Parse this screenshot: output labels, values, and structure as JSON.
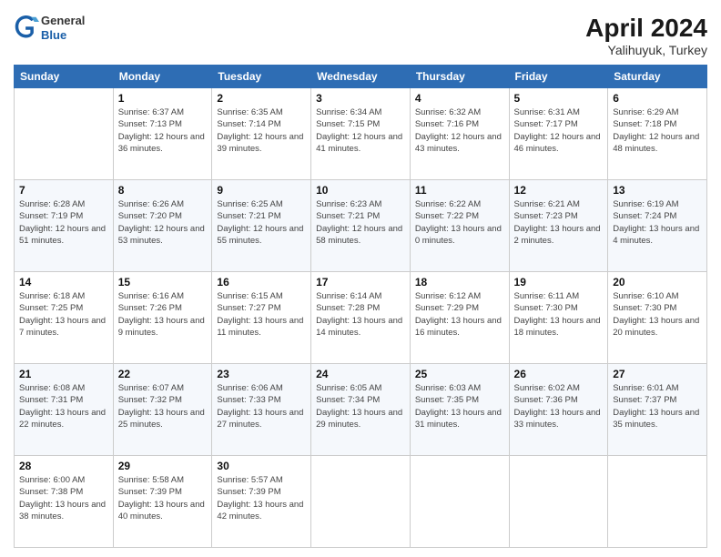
{
  "header": {
    "logo_general": "General",
    "logo_blue": "Blue",
    "title": "April 2024",
    "subtitle": "Yalihuyuk, Turkey"
  },
  "columns": [
    "Sunday",
    "Monday",
    "Tuesday",
    "Wednesday",
    "Thursday",
    "Friday",
    "Saturday"
  ],
  "weeks": [
    [
      {
        "day": "",
        "sunrise": "",
        "sunset": "",
        "daylight": ""
      },
      {
        "day": "1",
        "sunrise": "Sunrise: 6:37 AM",
        "sunset": "Sunset: 7:13 PM",
        "daylight": "Daylight: 12 hours and 36 minutes."
      },
      {
        "day": "2",
        "sunrise": "Sunrise: 6:35 AM",
        "sunset": "Sunset: 7:14 PM",
        "daylight": "Daylight: 12 hours and 39 minutes."
      },
      {
        "day": "3",
        "sunrise": "Sunrise: 6:34 AM",
        "sunset": "Sunset: 7:15 PM",
        "daylight": "Daylight: 12 hours and 41 minutes."
      },
      {
        "day": "4",
        "sunrise": "Sunrise: 6:32 AM",
        "sunset": "Sunset: 7:16 PM",
        "daylight": "Daylight: 12 hours and 43 minutes."
      },
      {
        "day": "5",
        "sunrise": "Sunrise: 6:31 AM",
        "sunset": "Sunset: 7:17 PM",
        "daylight": "Daylight: 12 hours and 46 minutes."
      },
      {
        "day": "6",
        "sunrise": "Sunrise: 6:29 AM",
        "sunset": "Sunset: 7:18 PM",
        "daylight": "Daylight: 12 hours and 48 minutes."
      }
    ],
    [
      {
        "day": "7",
        "sunrise": "Sunrise: 6:28 AM",
        "sunset": "Sunset: 7:19 PM",
        "daylight": "Daylight: 12 hours and 51 minutes."
      },
      {
        "day": "8",
        "sunrise": "Sunrise: 6:26 AM",
        "sunset": "Sunset: 7:20 PM",
        "daylight": "Daylight: 12 hours and 53 minutes."
      },
      {
        "day": "9",
        "sunrise": "Sunrise: 6:25 AM",
        "sunset": "Sunset: 7:21 PM",
        "daylight": "Daylight: 12 hours and 55 minutes."
      },
      {
        "day": "10",
        "sunrise": "Sunrise: 6:23 AM",
        "sunset": "Sunset: 7:21 PM",
        "daylight": "Daylight: 12 hours and 58 minutes."
      },
      {
        "day": "11",
        "sunrise": "Sunrise: 6:22 AM",
        "sunset": "Sunset: 7:22 PM",
        "daylight": "Daylight: 13 hours and 0 minutes."
      },
      {
        "day": "12",
        "sunrise": "Sunrise: 6:21 AM",
        "sunset": "Sunset: 7:23 PM",
        "daylight": "Daylight: 13 hours and 2 minutes."
      },
      {
        "day": "13",
        "sunrise": "Sunrise: 6:19 AM",
        "sunset": "Sunset: 7:24 PM",
        "daylight": "Daylight: 13 hours and 4 minutes."
      }
    ],
    [
      {
        "day": "14",
        "sunrise": "Sunrise: 6:18 AM",
        "sunset": "Sunset: 7:25 PM",
        "daylight": "Daylight: 13 hours and 7 minutes."
      },
      {
        "day": "15",
        "sunrise": "Sunrise: 6:16 AM",
        "sunset": "Sunset: 7:26 PM",
        "daylight": "Daylight: 13 hours and 9 minutes."
      },
      {
        "day": "16",
        "sunrise": "Sunrise: 6:15 AM",
        "sunset": "Sunset: 7:27 PM",
        "daylight": "Daylight: 13 hours and 11 minutes."
      },
      {
        "day": "17",
        "sunrise": "Sunrise: 6:14 AM",
        "sunset": "Sunset: 7:28 PM",
        "daylight": "Daylight: 13 hours and 14 minutes."
      },
      {
        "day": "18",
        "sunrise": "Sunrise: 6:12 AM",
        "sunset": "Sunset: 7:29 PM",
        "daylight": "Daylight: 13 hours and 16 minutes."
      },
      {
        "day": "19",
        "sunrise": "Sunrise: 6:11 AM",
        "sunset": "Sunset: 7:30 PM",
        "daylight": "Daylight: 13 hours and 18 minutes."
      },
      {
        "day": "20",
        "sunrise": "Sunrise: 6:10 AM",
        "sunset": "Sunset: 7:30 PM",
        "daylight": "Daylight: 13 hours and 20 minutes."
      }
    ],
    [
      {
        "day": "21",
        "sunrise": "Sunrise: 6:08 AM",
        "sunset": "Sunset: 7:31 PM",
        "daylight": "Daylight: 13 hours and 22 minutes."
      },
      {
        "day": "22",
        "sunrise": "Sunrise: 6:07 AM",
        "sunset": "Sunset: 7:32 PM",
        "daylight": "Daylight: 13 hours and 25 minutes."
      },
      {
        "day": "23",
        "sunrise": "Sunrise: 6:06 AM",
        "sunset": "Sunset: 7:33 PM",
        "daylight": "Daylight: 13 hours and 27 minutes."
      },
      {
        "day": "24",
        "sunrise": "Sunrise: 6:05 AM",
        "sunset": "Sunset: 7:34 PM",
        "daylight": "Daylight: 13 hours and 29 minutes."
      },
      {
        "day": "25",
        "sunrise": "Sunrise: 6:03 AM",
        "sunset": "Sunset: 7:35 PM",
        "daylight": "Daylight: 13 hours and 31 minutes."
      },
      {
        "day": "26",
        "sunrise": "Sunrise: 6:02 AM",
        "sunset": "Sunset: 7:36 PM",
        "daylight": "Daylight: 13 hours and 33 minutes."
      },
      {
        "day": "27",
        "sunrise": "Sunrise: 6:01 AM",
        "sunset": "Sunset: 7:37 PM",
        "daylight": "Daylight: 13 hours and 35 minutes."
      }
    ],
    [
      {
        "day": "28",
        "sunrise": "Sunrise: 6:00 AM",
        "sunset": "Sunset: 7:38 PM",
        "daylight": "Daylight: 13 hours and 38 minutes."
      },
      {
        "day": "29",
        "sunrise": "Sunrise: 5:58 AM",
        "sunset": "Sunset: 7:39 PM",
        "daylight": "Daylight: 13 hours and 40 minutes."
      },
      {
        "day": "30",
        "sunrise": "Sunrise: 5:57 AM",
        "sunset": "Sunset: 7:39 PM",
        "daylight": "Daylight: 13 hours and 42 minutes."
      },
      {
        "day": "",
        "sunrise": "",
        "sunset": "",
        "daylight": ""
      },
      {
        "day": "",
        "sunrise": "",
        "sunset": "",
        "daylight": ""
      },
      {
        "day": "",
        "sunrise": "",
        "sunset": "",
        "daylight": ""
      },
      {
        "day": "",
        "sunrise": "",
        "sunset": "",
        "daylight": ""
      }
    ]
  ]
}
